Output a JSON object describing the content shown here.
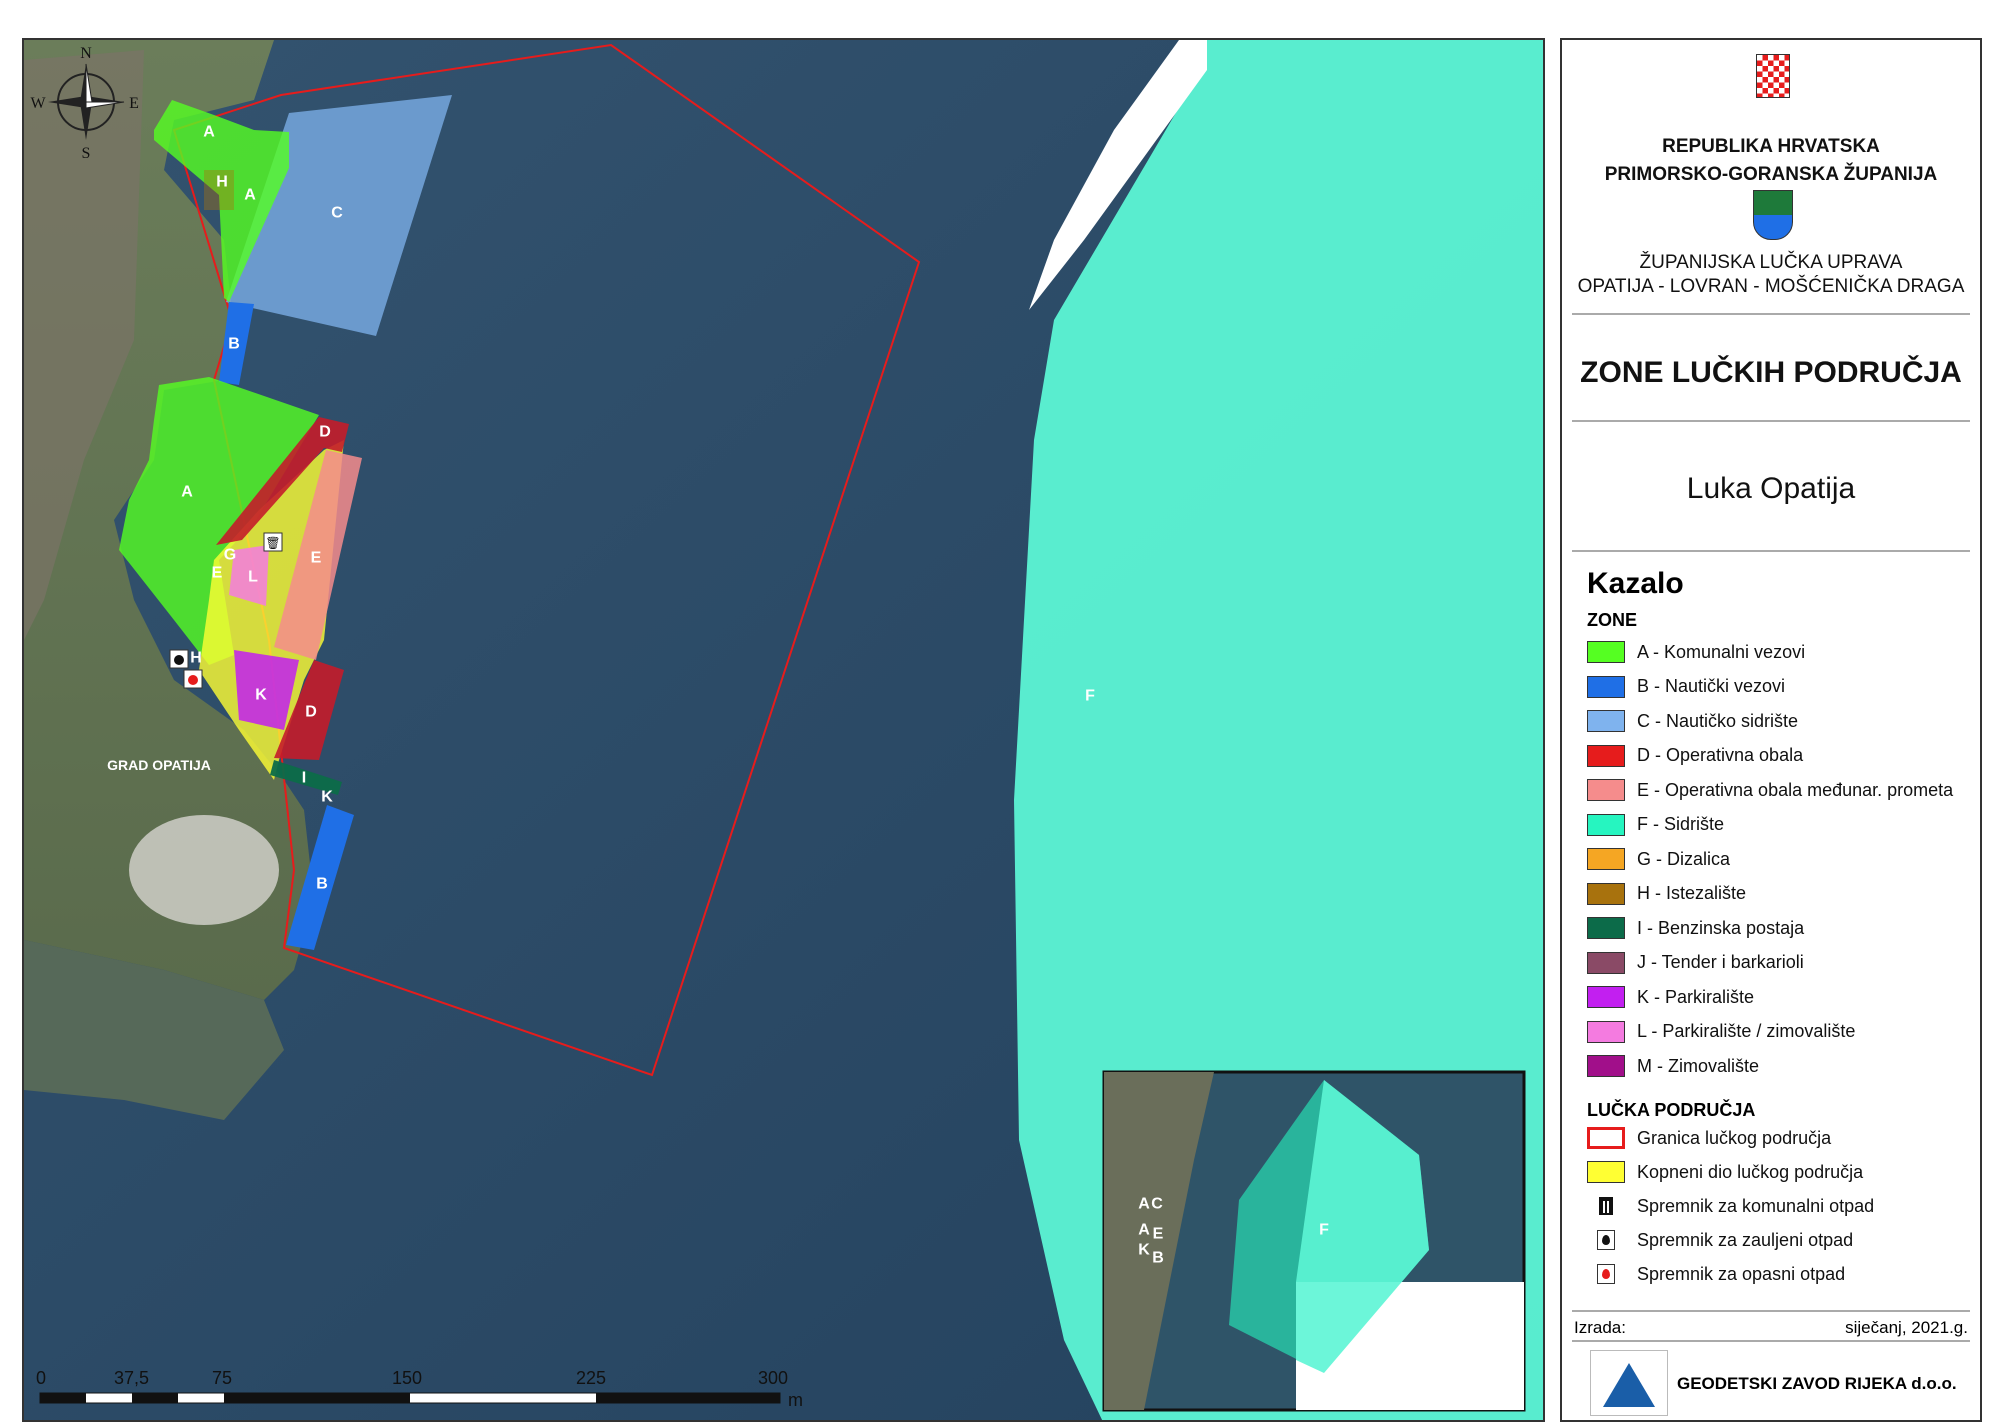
{
  "map": {
    "compass": {
      "n": "N",
      "s": "S",
      "e": "E",
      "w": "W"
    },
    "place_label": "GRAD OPATIJA",
    "zone_labels": {
      "a1": "A",
      "a2": "A",
      "a3": "A",
      "h1": "H",
      "h2": "H",
      "c": "C",
      "b1": "B",
      "b2": "B",
      "d1": "D",
      "d2": "D",
      "e1": "E",
      "e2": "E",
      "g": "G",
      "l": "L",
      "k1": "K",
      "k2": "K",
      "i": "I",
      "f": "F"
    },
    "inset_labels": {
      "a1": "A",
      "c": "C",
      "a2": "A",
      "e": "E",
      "k": "K",
      "b": "B",
      "f": "F"
    },
    "scale_bar": {
      "ticks": [
        "0",
        "37,5",
        "75",
        "150",
        "225",
        "300"
      ],
      "unit": "m"
    }
  },
  "legend": {
    "org_line1": "REPUBLIKA HRVATSKA",
    "org_line2": "PRIMORSKO-GORANSKA ŽUPANIJA",
    "authority_line1": "ŽUPANIJSKA LUČKA UPRAVA",
    "authority_line2": "OPATIJA - LOVRAN - MOŠĆENIČKA DRAGA",
    "map_title": "ZONE LUČKIH PODRUČJA",
    "map_subtitle": "Luka Opatija",
    "legend_title": "Kazalo",
    "zones_heading": "ZONE",
    "zones": [
      {
        "label": "A - Komunalni vezovi",
        "color": "#55ff22"
      },
      {
        "label": "B - Nautički vezovi",
        "color": "#1f6fe6"
      },
      {
        "label": "C - Nautičko sidrište",
        "color": "#7fb3ee"
      },
      {
        "label": "D - Operativna obala",
        "color": "#e61c1c"
      },
      {
        "label": "E - Operativna obala međunar. prometa",
        "color": "#f58c8c"
      },
      {
        "label": "F - Sidrište",
        "color": "#26f5c0"
      },
      {
        "label": "G - Dizalica",
        "color": "#f5a623"
      },
      {
        "label": "H - Istezalište",
        "color": "#a8720d"
      },
      {
        "label": "I - Benzinska postaja",
        "color": "#0c6b49"
      },
      {
        "label": "J - Tender i barkarioli",
        "color": "#8a4a66"
      },
      {
        "label": "K - Parkiralište",
        "color": "#c21ff0"
      },
      {
        "label": "L - Parkiralište / zimovalište",
        "color": "#f47be0"
      },
      {
        "label": "M - Zimovalište",
        "color": "#a10f8a"
      }
    ],
    "areas_heading": "LUČKA PODRUČJA",
    "areas": [
      {
        "label": "Granica lučkog područja",
        "color": "#e61c1c",
        "kind": "outline"
      },
      {
        "label": "Kopneni dio lučkog područja",
        "color": "#ffff33",
        "kind": "fill"
      }
    ],
    "waste": [
      {
        "label": "Spremnik za komunalni otpad",
        "icon": "trash-bin-icon"
      },
      {
        "label": "Spremnik za zauljeni otpad",
        "icon": "oil-drop-icon"
      },
      {
        "label": "Spremnik za opasni otpad",
        "icon": "hazard-drop-icon"
      }
    ],
    "made_by_label": "Izrada:",
    "date": "siječanj, 2021.g.",
    "company": "GEODETSKI ZAVOD RIJEKA d.o.o."
  }
}
